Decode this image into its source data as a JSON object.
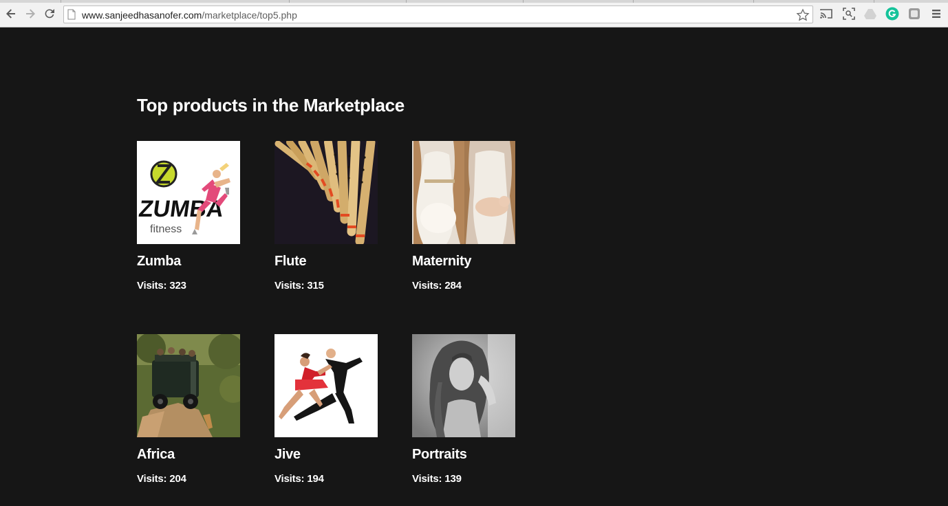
{
  "browser": {
    "url_host": "www.sanjeedhasanofer.com",
    "url_path": "/marketplace/top5.php",
    "icons": [
      "back-icon",
      "forward-icon",
      "reload-icon",
      "page-icon",
      "star-icon",
      "cast-icon",
      "screenshot-icon",
      "drive-icon",
      "grammarly-icon",
      "extension-icon",
      "menu-icon"
    ],
    "grammarly_color": "#15c39a"
  },
  "page": {
    "title": "Top products in the Marketplace",
    "background": "#161616",
    "visits_label": "Visits:",
    "products": [
      {
        "name": "Zumba",
        "visits": "323",
        "image": "zumba fitness logo with dancer"
      },
      {
        "name": "Flute",
        "visits": "315",
        "image": "bamboo flutes"
      },
      {
        "name": "Maternity",
        "visits": "284",
        "image": "maternity and newborn photos"
      },
      {
        "name": "Africa",
        "visits": "204",
        "image": "safari jeep"
      },
      {
        "name": "Jive",
        "visits": "194",
        "image": "dancing couple"
      },
      {
        "name": "Portraits",
        "visits": "139",
        "image": "black and white portrait"
      }
    ]
  }
}
